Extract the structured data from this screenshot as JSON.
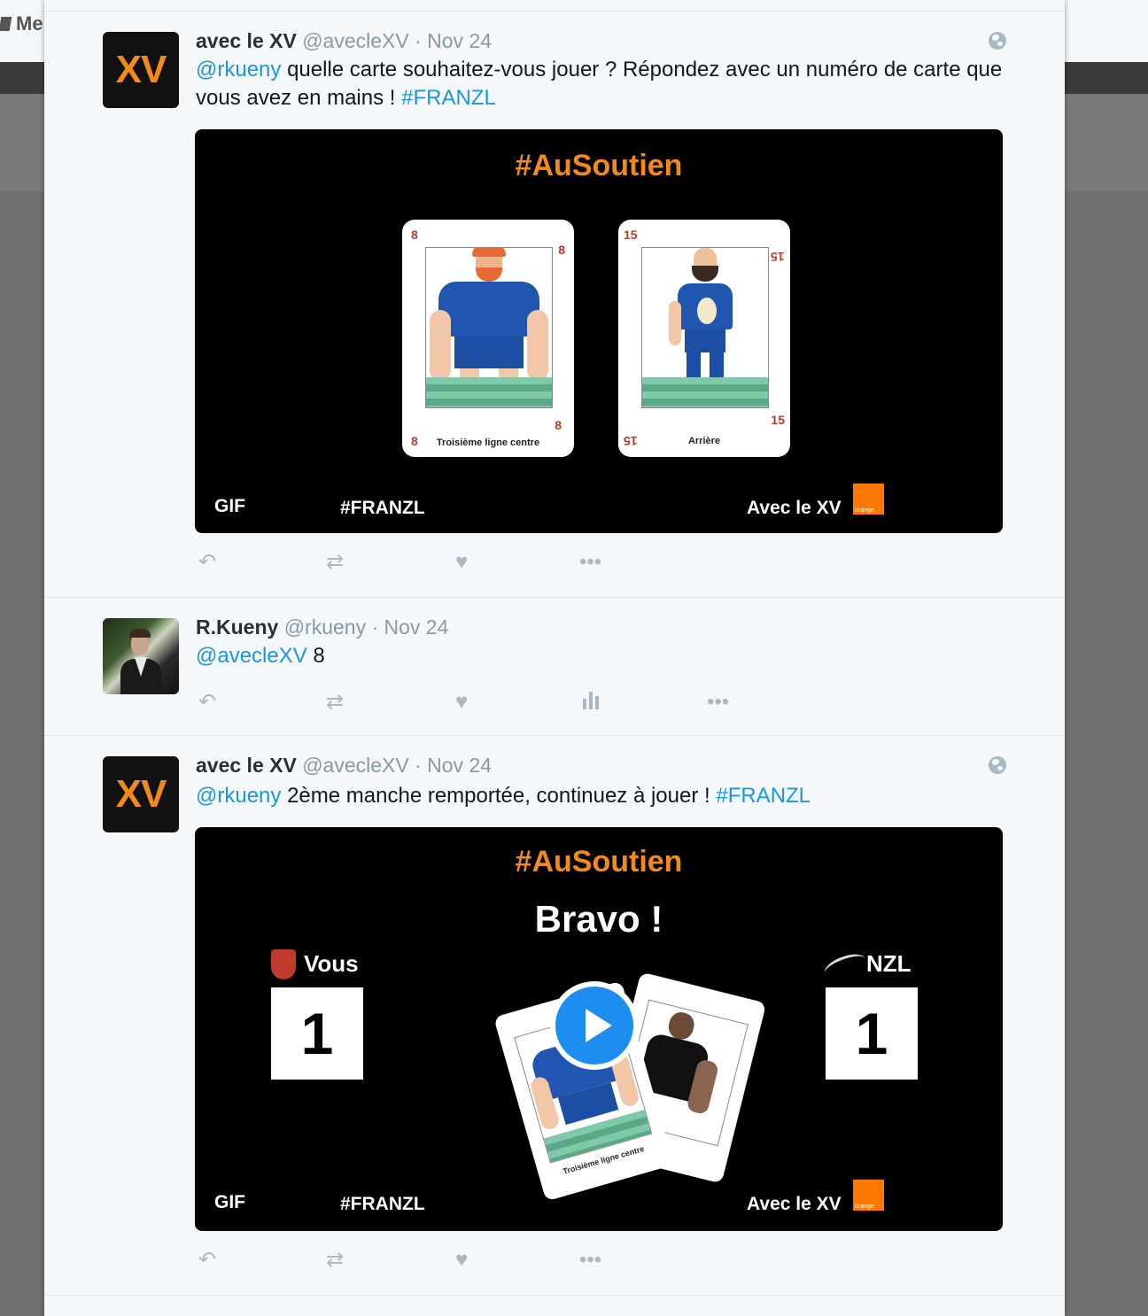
{
  "background": {
    "label": "Me"
  },
  "tweets": [
    {
      "name": "avec le XV",
      "handle": "@avecleXV",
      "date": "· Nov 24",
      "avatar_text": "XV",
      "mention": "@rkueny",
      "text": " quelle carte souhaitez-vous jouer ? Répondez avec un numéro de carte que vous avez en mains ! ",
      "hashtag": "#FRANZL",
      "media": {
        "tag": "#AuSoutien",
        "gif": "GIF",
        "franzl": "#FRANZL",
        "avec": "Avec le XV",
        "orange": "orange",
        "card1": {
          "num": "8",
          "caption": "Troisième ligne centre"
        },
        "card2": {
          "num": "15",
          "caption": "Arrière"
        }
      }
    },
    {
      "name": "R.Kueny",
      "handle": "@rkueny",
      "date": "· Nov 24",
      "mention": "@avecleXV",
      "text": " 8"
    },
    {
      "name": "avec le XV",
      "handle": "@avecleXV",
      "date": "· Nov 24",
      "avatar_text": "XV",
      "mention": "@rkueny",
      "text": " 2ème manche remportée, continuez à jouer ! ",
      "hashtag": "#FRANZL",
      "media": {
        "tag": "#AuSoutien",
        "bravo": "Bravo !",
        "team_left": "Vous",
        "team_right": "NZL",
        "score_left": "1",
        "score_right": "1",
        "card_caption": "Troisième ligne centre",
        "gif": "GIF",
        "franzl": "#FRANZL",
        "avec": "Avec le XV",
        "orange": "orange"
      }
    }
  ],
  "icons": {
    "reply": "reply-icon",
    "retweet": "retweet-icon",
    "like": "heart-icon",
    "analytics": "analytics-icon",
    "more": "more-icon",
    "globe": "globe-icon"
  },
  "colors": {
    "link": "#1b95e0",
    "accent_orange": "#f28a1a",
    "muted": "#8899a6"
  }
}
